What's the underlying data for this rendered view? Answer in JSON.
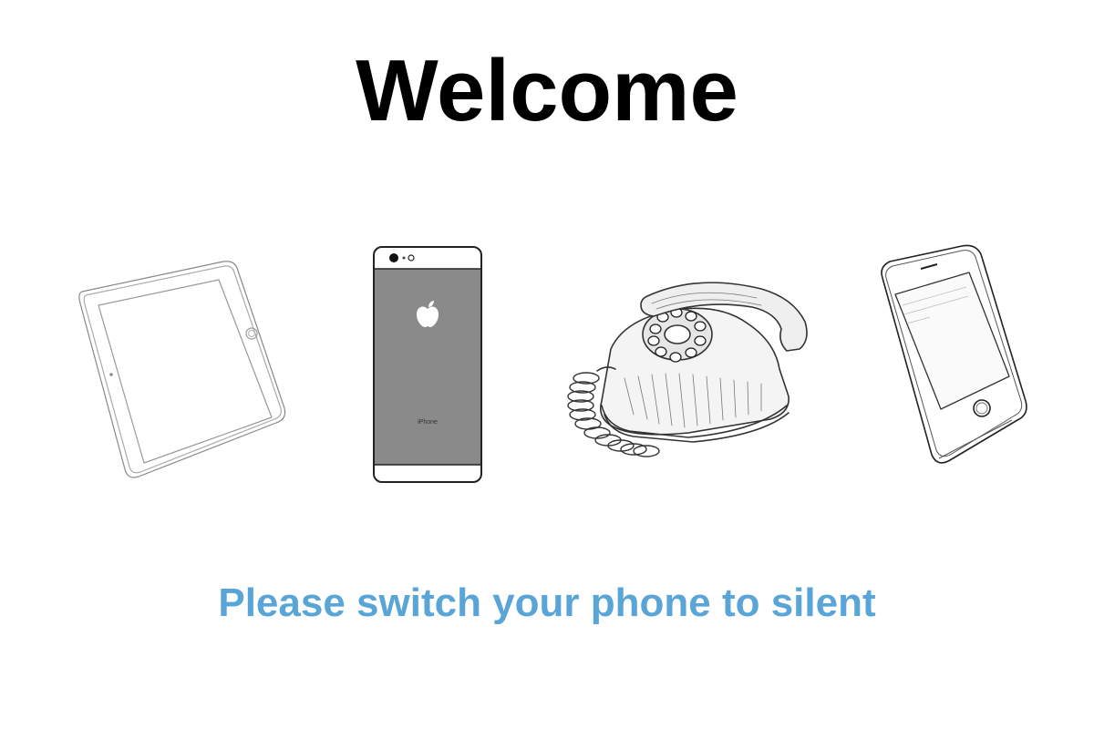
{
  "slide": {
    "title": "Welcome",
    "message": "Please switch your phone to silent"
  },
  "illustrations": [
    {
      "name": "tablet-sketch-icon"
    },
    {
      "name": "smartphone-back-sketch-icon",
      "engraving": "iPhone"
    },
    {
      "name": "rotary-telephone-sketch-icon"
    },
    {
      "name": "smartphone-front-sketch-icon"
    }
  ],
  "colors": {
    "title": "#000000",
    "message": "#5aa5d8",
    "phone_back": "#8a8a8a",
    "sketch_line": "#333333"
  }
}
